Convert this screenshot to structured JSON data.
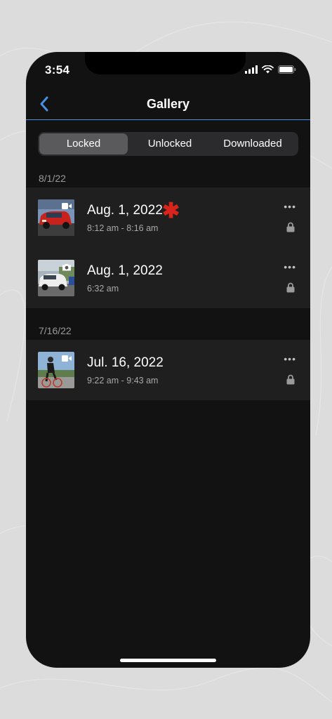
{
  "status": {
    "time": "3:54"
  },
  "nav": {
    "title": "Gallery"
  },
  "tabs": [
    {
      "label": "Locked",
      "active": true
    },
    {
      "label": "Unlocked",
      "active": false
    },
    {
      "label": "Downloaded",
      "active": false
    }
  ],
  "sections": [
    {
      "header": "8/1/22",
      "items": [
        {
          "title": "Aug. 1, 2022",
          "subtitle": "8:12 am - 8:16 am",
          "media_type": "video-icon",
          "starred": true,
          "star_symbol": "✱"
        },
        {
          "title": "Aug. 1, 2022",
          "subtitle": "6:32 am",
          "media_type": "camera-icon",
          "starred": false
        }
      ]
    },
    {
      "header": "7/16/22",
      "items": [
        {
          "title": "Jul. 16, 2022",
          "subtitle": "9:22 am - 9:43 am",
          "media_type": "video-icon",
          "starred": false
        }
      ]
    }
  ],
  "icons": {
    "more": "•••",
    "lock": "lock-icon",
    "back": "chevron-left-icon"
  },
  "colors": {
    "accent": "#4a90e2",
    "star": "#d9241c",
    "background": "#121212",
    "row": "#1f1f1f"
  }
}
